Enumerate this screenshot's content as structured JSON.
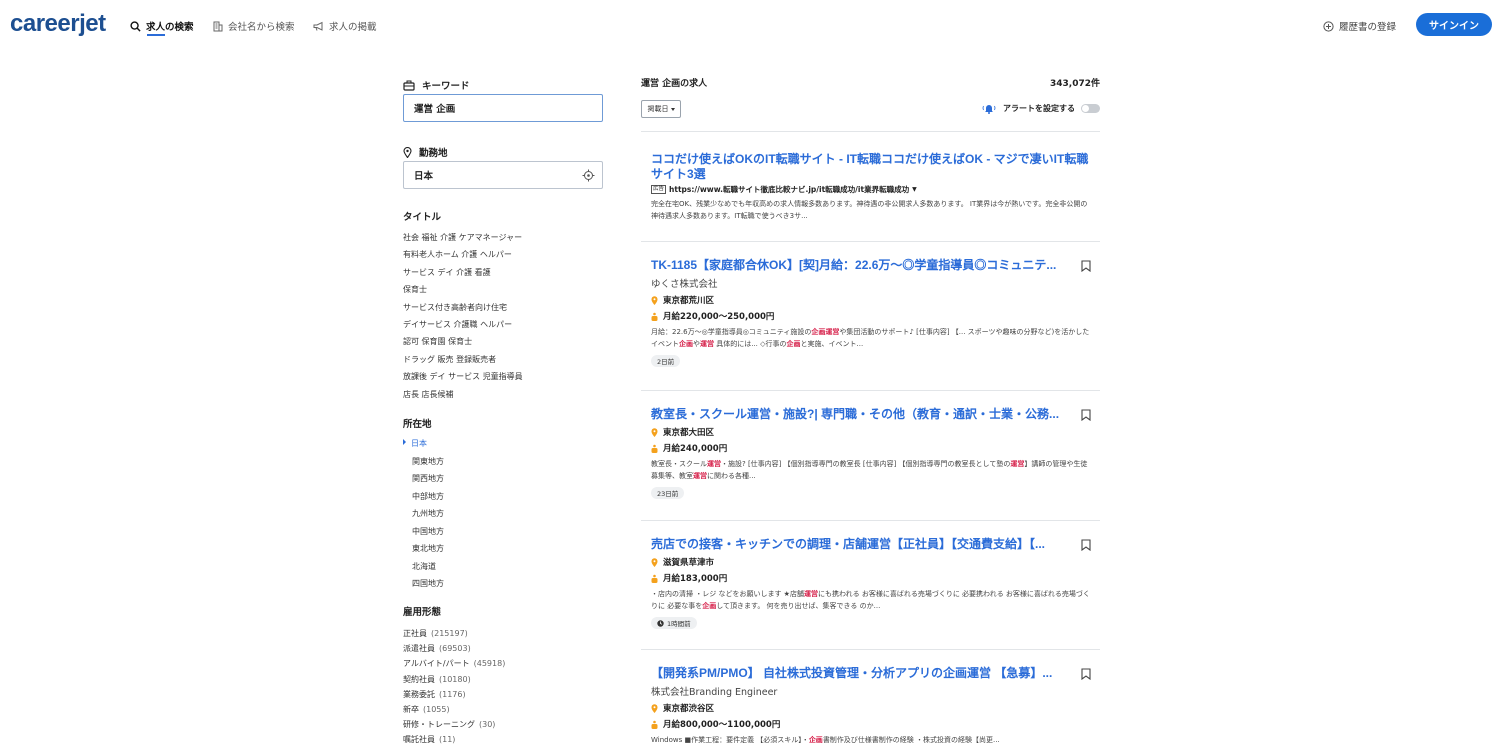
{
  "header": {
    "logo": "careerjet",
    "nav": [
      {
        "label": "求人の検索",
        "icon": "search-icon",
        "active": true
      },
      {
        "label": "会社名から検索",
        "icon": "building-icon",
        "active": false
      },
      {
        "label": "求人の掲載",
        "icon": "megaphone-icon",
        "active": false
      }
    ],
    "resume_label": "履歴書の登録",
    "signin_label": "サインイン",
    "accent_color": "#1a6ed8",
    "brand_color": "#1d4f91"
  },
  "search": {
    "keyword_label": "キーワード",
    "keyword_value": "運営 企画",
    "location_label": "勤務地",
    "location_value": "日本"
  },
  "filters": {
    "title_heading": "タイトル",
    "titles": [
      "社会 福祉 介護 ケアマネージャー",
      "有料老人ホーム 介護 ヘルパー",
      "サービス デイ 介護 看護",
      "保育士",
      "サービス付き高齢者向け住宅",
      "デイサービス 介護職 ヘルパー",
      "認可 保育園 保育士",
      "ドラッグ 販売 登録販売者",
      "放課後 デイ サービス 児童指導員",
      "店長 店長候補"
    ],
    "location_heading": "所在地",
    "locations": {
      "current": "日本",
      "regions": [
        "関東地方",
        "関西地方",
        "中部地方",
        "九州地方",
        "中国地方",
        "東北地方",
        "北海道",
        "四国地方"
      ]
    },
    "type_heading": "雇用形態",
    "types": [
      {
        "label": "正社員",
        "count": "(215197)"
      },
      {
        "label": "派遣社員",
        "count": "(69503)"
      },
      {
        "label": "アルバイト/パート",
        "count": "(45918)"
      },
      {
        "label": "契約社員",
        "count": "(10180)"
      },
      {
        "label": "業務委託",
        "count": "(1176)"
      },
      {
        "label": "新卒",
        "count": "(1055)"
      },
      {
        "label": "研修・トレーニング",
        "count": "(30)"
      },
      {
        "label": "嘱託社員",
        "count": "(11)"
      }
    ]
  },
  "results": {
    "title": "運営 企画の求人",
    "count": "343,072件",
    "sort_label": "掲載日",
    "alert_label": "アラートを設定する",
    "ad": {
      "title": "ココだけ使えばOKのIT転職サイト - IT転職ココだけ使えばOK - マジで凄いIT転職サイト3選",
      "tag": "広告",
      "url": "https://www.転職サイト徹底比較ナビ.jp/it転職成功/it業界転職成功",
      "desc": "完全在宅OK、残業少なめでも年収高めの求人情報多数あります。神待遇の非公開求人多数あります。 IT業界は今が熱いです。完全非公開の神待遇求人多数あります。IT転職で使うべき3サ..."
    },
    "jobs": [
      {
        "title": "TK-1185【家庭都合休OK】[契]月給：22.6万～◎学童指導員◎コミュニテ...",
        "company": "ゆくさ株式会社",
        "location": "東京都荒川区",
        "salary": "月給220,000～250,000円",
        "desc_parts": [
          {
            "t": "月給：22.6万～◎学童指導員◎コミュニティ施設の"
          },
          {
            "t": "企画運営",
            "hl": true
          },
          {
            "t": "や集団活動のサポート♪ [仕事内容] 【... スポーツや趣味の分野など)を活かしたイベント"
          },
          {
            "t": "企画",
            "hl": true
          },
          {
            "t": "や"
          },
          {
            "t": "運営",
            "hl": true
          },
          {
            "t": " 具体的には... ◇行事の"
          },
          {
            "t": "企画",
            "hl": true
          },
          {
            "t": "と実施、イベント..."
          }
        ],
        "age": "2日前",
        "clock": false
      },
      {
        "title": "教室長・スクール運営・施設?| 専門職・その他（教育・通訳・士業・公務...",
        "company": "",
        "location": "東京都大田区",
        "salary": "月給240,000円",
        "desc_parts": [
          {
            "t": "教室長・スクール"
          },
          {
            "t": "運営",
            "hl": true
          },
          {
            "t": "・施設? [仕事内容] 【個別指導専門の教室長 [仕事内容] 【個別指導専門の教室長として塾の"
          },
          {
            "t": "運営",
            "hl": true
          },
          {
            "t": "】講師の管理や生徒募集等、教室"
          },
          {
            "t": "運営",
            "hl": true
          },
          {
            "t": "に関わる各種..."
          }
        ],
        "age": "23日前",
        "clock": false
      },
      {
        "title": "売店での接客・キッチンでの調理・店舗運営【正社員】【交通費支給】【...",
        "company": "",
        "location": "滋賀県草津市",
        "salary": "月給183,000円",
        "desc_parts": [
          {
            "t": "・店内の清掃 ・レジ などをお願いします ★店舗"
          },
          {
            "t": "運営",
            "hl": true
          },
          {
            "t": "にも携われる お客様に喜ばれる売場づくりに 必要携われる お客様に喜ばれる売場づくりに 必要な事を"
          },
          {
            "t": "企画",
            "hl": true
          },
          {
            "t": "して頂きます。 何を売り出せば、集客できる のか..."
          }
        ],
        "age": "1時間前",
        "clock": true
      },
      {
        "title": "【開発系PM/PMO】 自社株式投資管理・分析アプリの企画運営 【急募】...",
        "company": "株式会社Branding Engineer",
        "location": "東京都渋谷区",
        "salary": "月給800,000～1100,000円",
        "desc_parts": [
          {
            "t": "Windows ■作業工程：要件定義 【必須スキル】・"
          },
          {
            "t": "企画",
            "hl": true
          },
          {
            "t": "書制作及び仕様書制作の経験 ・株式投資の経験【尚更..."
          }
        ],
        "age": "",
        "clock": false
      }
    ]
  },
  "icons": {
    "pin_color": "#f4a11d",
    "highlight_color": "#d6204a",
    "link_color": "#2b6cd8"
  }
}
